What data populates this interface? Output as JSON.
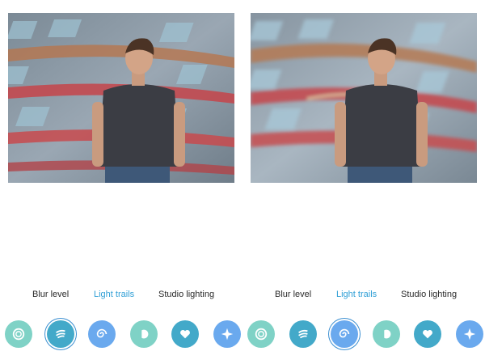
{
  "colors": {
    "accent": "#2f9fd6",
    "teal": "#7fd2c6",
    "teal_dark": "#43a9c9",
    "blue": "#6aa9ee",
    "ring": "#3b8fd1"
  },
  "panels": [
    {
      "photo_icon": "portrait-photo",
      "modes": {
        "blur_level": "Blur level",
        "light_trails": "Light trails",
        "studio_lighting": "Studio lighting"
      },
      "selected_effect": 2
    },
    {
      "photo_icon": "portrait-photo-blurred",
      "modes": {
        "blur_level": "Blur level",
        "light_trails": "Light trails",
        "studio_lighting": "Studio lighting"
      },
      "selected_effect": 3
    }
  ],
  "effects": [
    {
      "icon": "concentric-circles-icon"
    },
    {
      "icon": "swoosh-lines-icon"
    },
    {
      "icon": "spiral-icon"
    },
    {
      "icon": "half-circle-icon"
    },
    {
      "icon": "heart-icon"
    },
    {
      "icon": "sparkle-icon"
    }
  ]
}
